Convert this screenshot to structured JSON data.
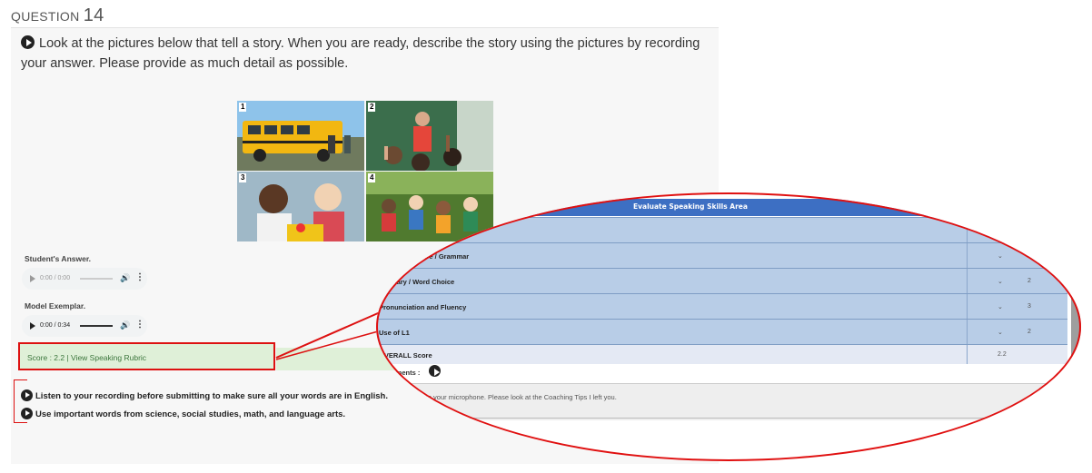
{
  "question": {
    "prefix": "QUESTION",
    "number": "14"
  },
  "prompt": "Look at the pictures below that tell a story. When you are ready, describe the story using the pictures by recording your answer. Please provide as much detail as possible.",
  "pictures": [
    {
      "number": "1",
      "icon": "school-bus-photo"
    },
    {
      "number": "2",
      "icon": "classroom-teacher-photo"
    },
    {
      "number": "3",
      "icon": "kids-lunch-photo"
    },
    {
      "number": "4",
      "icon": "kids-outdoors-photo"
    }
  ],
  "student_answer": {
    "label": "Student's Answer.",
    "time": "0:00 / 0:00",
    "progress": 0
  },
  "model_exemplar": {
    "label": "Model Exemplar.",
    "time": "0:00 / 0:34",
    "progress": 0
  },
  "score_line": "Score : 2.2 | View Speaking Rubric",
  "tips": [
    "Listen to your recording before submitting to make sure all your words are in English.",
    "Use important words from science, social studies, math, and language arts."
  ],
  "rubric": {
    "title": "Evaluate Speaking Skills Area",
    "rows": [
      {
        "name": "ntence Structure / Grammar",
        "value": "2"
      },
      {
        "name": "cabulary / Word Choice",
        "value": "2"
      },
      {
        "name": "Pronunciation and Fluency",
        "value": "3"
      },
      {
        "name": "Use of L1",
        "value": "2"
      }
    ],
    "overall": {
      "name": "OVERALL Score",
      "value": "2.2"
    },
    "comments_label": "r Comments :",
    "comment_text": "spoke clearly into your microphone. Please look at the Coaching Tips I left you.",
    "small_text": "mple average"
  },
  "colors": {
    "highlight_red": "#d11111",
    "rubric_header": "#3d6fc3",
    "rubric_row": "#b8cde7",
    "score_green": "#dff0d8"
  }
}
